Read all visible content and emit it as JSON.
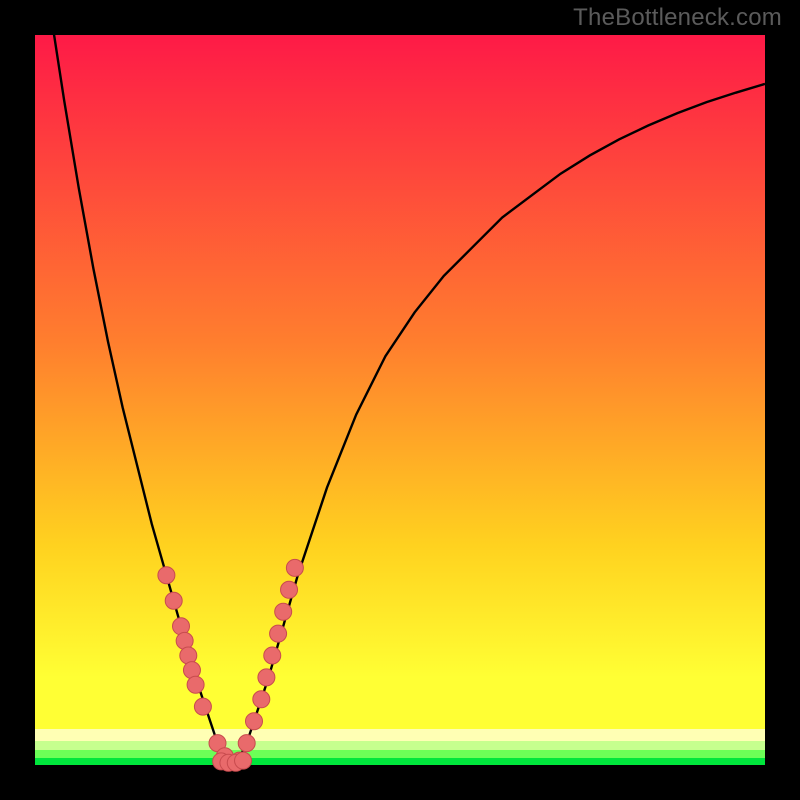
{
  "watermark": "TheBottleneck.com",
  "colors": {
    "frame": "#000000",
    "grad_top": "#fe1a47",
    "grad_mid1": "#ff7e2e",
    "grad_mid2": "#ffd21f",
    "grad_mid3": "#ffff34",
    "band_yellowpale": "#ffffb4",
    "band_greenlight": "#c6ff8e",
    "band_green": "#6cff57",
    "band_greenstrong": "#00e63c",
    "curve": "#000000",
    "dot_fill": "#e96a6b",
    "dot_stroke": "#c84b4e"
  },
  "chart_data": {
    "type": "line",
    "title": "",
    "xlabel": "",
    "ylabel": "",
    "xlim": [
      0,
      100
    ],
    "ylim": [
      0,
      100
    ],
    "x_min_at": 27,
    "series": [
      {
        "name": "bottleneck-curve",
        "x": [
          0,
          2,
          4,
          6,
          8,
          10,
          12,
          14,
          16,
          18,
          20,
          22,
          24,
          25,
          26,
          27,
          28,
          29,
          30,
          32,
          34,
          36,
          38,
          40,
          44,
          48,
          52,
          56,
          60,
          64,
          68,
          72,
          76,
          80,
          84,
          88,
          92,
          96,
          100
        ],
        "y": [
          118,
          104,
          91,
          79,
          68,
          58,
          49,
          41,
          33,
          26,
          19,
          12,
          6,
          3,
          1,
          0,
          1,
          3,
          6,
          12,
          19,
          26,
          32,
          38,
          48,
          56,
          62,
          67,
          71,
          75,
          78,
          81,
          83.5,
          85.7,
          87.6,
          89.3,
          90.8,
          92.1,
          93.3
        ]
      }
    ],
    "dots_left": {
      "x": [
        18,
        19,
        20,
        20.5,
        21,
        21.5,
        22,
        23,
        25,
        26,
        28
      ],
      "y": [
        26,
        22.5,
        19,
        17,
        15,
        13,
        11,
        8,
        3,
        1.2,
        0.6
      ]
    },
    "dots_right": {
      "x": [
        29,
        30,
        31,
        31.7,
        32.5,
        33.3,
        34,
        34.8,
        35.6
      ],
      "y": [
        3,
        6,
        9,
        12,
        15,
        18,
        21,
        24,
        27
      ]
    },
    "dots_bottom": {
      "x": [
        25.5,
        26.5,
        27.5,
        28.5
      ],
      "y": [
        0.5,
        0.3,
        0.3,
        0.6
      ]
    }
  }
}
